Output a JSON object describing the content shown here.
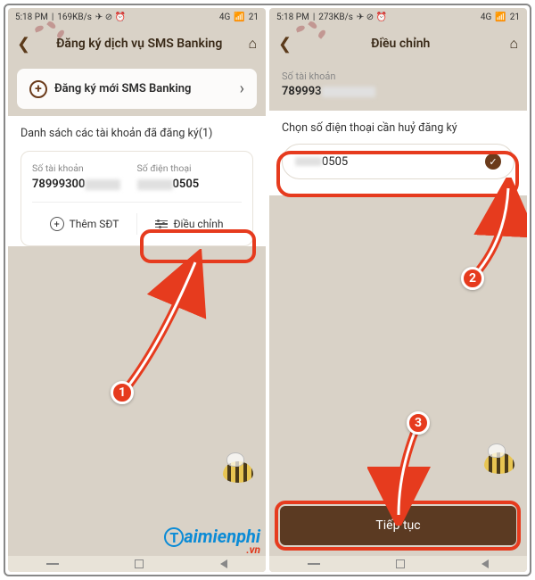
{
  "status": {
    "time": "5:18 PM",
    "speed1": "169KB/s",
    "speed2": "273KB/s",
    "net": "4G",
    "bat": "21"
  },
  "left": {
    "header_title": "Đăng ký dịch vụ SMS Banking",
    "register_new": "Đăng ký mới SMS Banking",
    "list_title": "Danh sách các tài khoản đã đăng ký(1)",
    "acct_label": "Số tài khoản",
    "acct_value": "78999300",
    "phone_label": "Số điện thoại",
    "phone_value": "0505",
    "add_phone": "Thêm SĐT",
    "adjust": "Điều chỉnh"
  },
  "right": {
    "header_title": "Điều chỉnh",
    "acct_label": "Số tài khoản",
    "acct_value": "789993",
    "select_title": "Chọn số điện thoại cần huỷ đăng ký",
    "phone_value": "0505",
    "continue": "Tiếp tục"
  },
  "badges": {
    "b1": "1",
    "b2": "2",
    "b3": "3"
  },
  "watermark": {
    "t": "T",
    "rest": "aimienphi",
    "vn": ".vn"
  }
}
